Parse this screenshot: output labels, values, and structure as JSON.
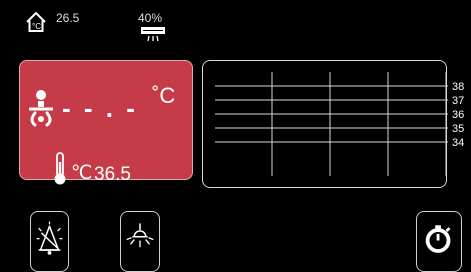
{
  "status_bar": {
    "room_temperature": "26.5",
    "humidity": "40%"
  },
  "baby_panel": {
    "baby_temperature": "- - . -",
    "baby_unit": "˚C",
    "skin_unit": "℃",
    "skin_temperature": "36.5",
    "background_color": "#c53b47"
  },
  "chart_data": {
    "type": "line",
    "y_tick_labels": [
      "38",
      "37",
      "36",
      "35",
      "34"
    ],
    "ylim": [
      34,
      38
    ],
    "grid": true,
    "series": []
  },
  "icons": {
    "home": "home-thermometer-icon",
    "humidifier": "humidifier-icon",
    "baby": "baby-icon",
    "thermometer": "thermometer-icon",
    "alarm": "alarm-bell-icon",
    "light": "lamp-icon",
    "timer": "timer-icon"
  }
}
